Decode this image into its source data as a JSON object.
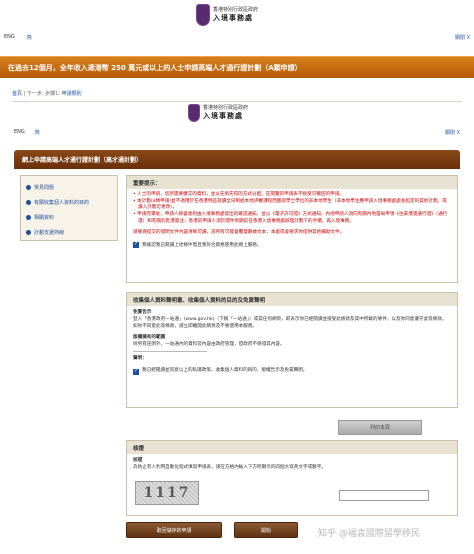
{
  "header": {
    "dept_line1": "香港特別行政區政府",
    "dept_line2": "入境事務處",
    "lang_eng": "ENG",
    "lang_simplified": "简",
    "close_label": "關閉 X"
  },
  "title_bar": "在過去12個月，全年收入達港幣 250 萬元或以上的人士申請高端人才通行證計劃（A類申請）",
  "breadcrumb": {
    "home": "首頁",
    "sep1": " | 下一步: ",
    "step": "步驟1: ",
    "current": "申請類別"
  },
  "inner_lang": {
    "eng": "ENG",
    "simplified": "简",
    "close": "關閉 X"
  },
  "inner_title": "網上申請高端人才通行證計劃（高才通計劃）",
  "sidebar": {
    "items": [
      {
        "label": "常見問題"
      },
      {
        "label": "有關收集個人資料的目的"
      },
      {
        "label": "相關資料"
      },
      {
        "label": "計劃支援熱線"
      }
    ]
  },
  "important": {
    "title": "重要提示：",
    "items": [
      "人士的申請，您所需要繳交的資料，並以先到先得的方式分配。在閱覽的申請表不接受可撤回的申請。",
      "本計劃(a類申請)並不適用於在香港特區就讀全日制經本地評審課程而獲得學士學位的非本地學生（非本地學生應申請入境事務處處長指定的其他計劃，或讀入計劃可更改），",
      "申請完畢後，申請人將會收到由入境事務處發出的確認通知，並以《電子許可證》方式通知，內地申請人須向有關內地當局申領《往來港澳通行證》（通行證）和有關的赴港簽注，香港的申請人須於證件到期前在香港入境事務處辦理計劃下的手續，再入境事務。"
    ],
    "note": "請確保提交的證明文件內容清晰可讀，該所有可能會覆蓋數據文本，本處或會要求你提供其他輔助文件。",
    "agree": "我確認我已閱讀上述條件而且我符合資格使用此網上服務。"
  },
  "privacy": {
    "title": "收集個人資料聲明書、收集個人資料的目的及免責聲明",
    "h1": "免責告示",
    "p1": "登入「香港政府一站通」(www.gov.hk)（下稱「一站通」）或其任何網頁，即表示你已經閱讀並接受此條款及其中所載的條件，以及你同意遵守此等條款。如你不同意此等條款，請立即離開此網頁及不要使用本服務。",
    "h2": "版權擁有的範圍",
    "p2": "除另有註明外，一站通內的資料及內容由政府管理，但政府不保證其內容。",
    "h3": "聲明：",
    "agree": "我已經閱讀並同意以上的私隱政策、收集個人資料的目的、版權告示及免責聲明。"
  },
  "print_button": "列印本頁",
  "verify": {
    "title": "核證",
    "h1": "核證",
    "p1": "為防止有人利用自動化程式填寫申請表，請在方格內輸入下方所顯示的四個大寫英文字或數字。",
    "captcha_text": "1117"
  },
  "buttons": {
    "save": "取回儲存的申請",
    "start": "開始"
  },
  "watermark": "知乎 @福袁國際留學移民"
}
